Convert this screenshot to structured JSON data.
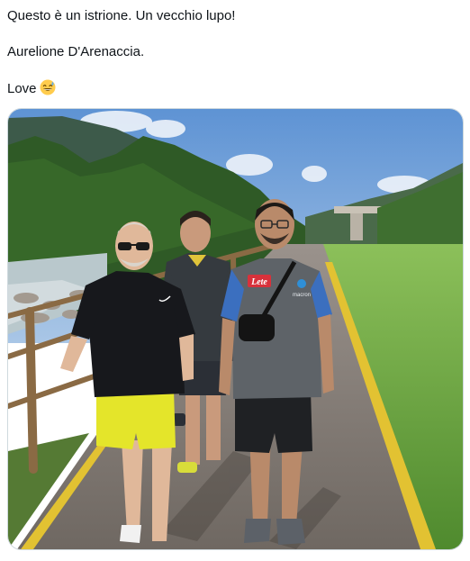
{
  "tweet": {
    "lines": [
      "Questo è un istrione. Un vecchio lupo!",
      "Aurelione D'Arenaccia.",
      "Love"
    ],
    "emoji": "grinning-face-with-sweat-icon"
  },
  "photo": {
    "shirt_badge_text": "Lete",
    "sponsor_text": "macron",
    "colors": {
      "sky": "#6f9fd8",
      "grass": "#5f9a3a",
      "path": "#8c8580",
      "lane_line": "#e2c232"
    }
  }
}
